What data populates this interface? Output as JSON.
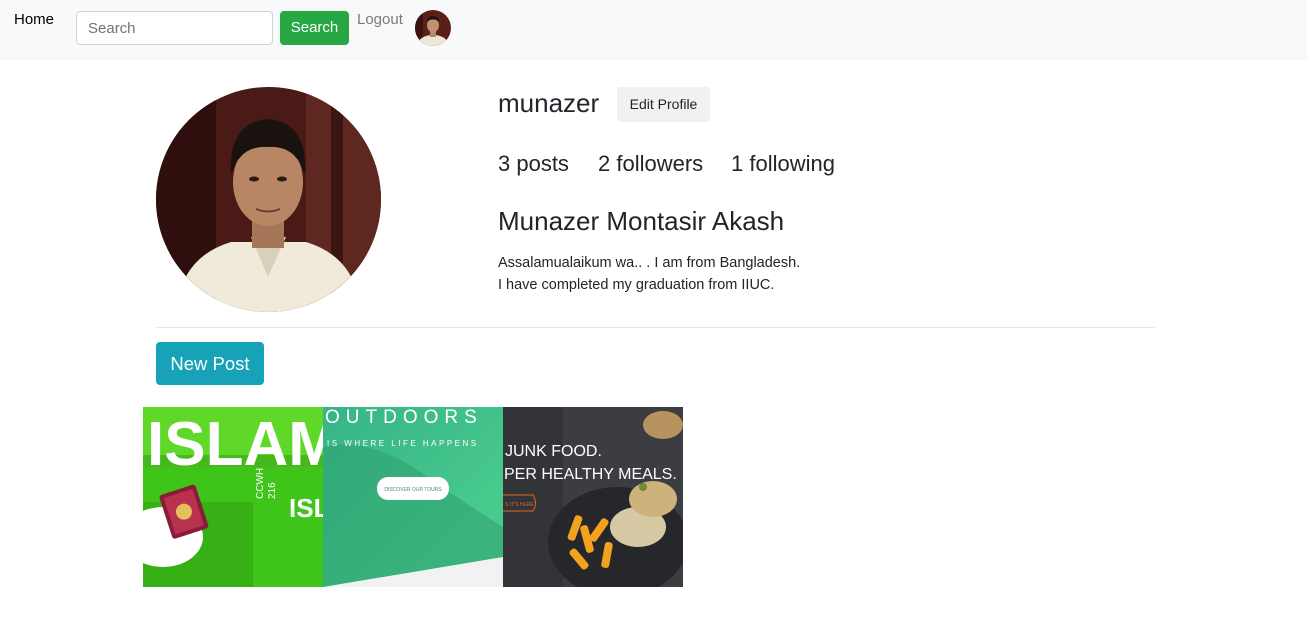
{
  "nav": {
    "home_label": "Home",
    "search_placeholder": "Search",
    "search_button_label": "Search",
    "logout_label": "Logout"
  },
  "profile": {
    "username": "munazer",
    "edit_button_label": "Edit Profile",
    "stats": {
      "posts": "3 posts",
      "followers": "2 followers",
      "following": "1 following"
    },
    "full_name": "Munazer Montasir Akash",
    "bio_lines": [
      "Assalamualaikum wa.. . I am from Bangladesh.",
      "I have completed my graduation from IIUC."
    ]
  },
  "actions": {
    "new_post_label": "New Post"
  },
  "posts": [
    {
      "id": "islam",
      "texts": [
        "ISLAM",
        "CCWH",
        "216",
        "ISLA"
      ]
    },
    {
      "id": "outdoors",
      "texts": [
        "OUTDOORS",
        "IS WHERE LIFE HAPPENS",
        "DISCOVER OUR TOURS"
      ]
    },
    {
      "id": "food",
      "texts": [
        "JUNK FOOD.",
        "PER HEALTHY MEALS.",
        "S IT'S HERE"
      ]
    }
  ],
  "colors": {
    "search_button": "#28a745",
    "new_post_button": "#17a2b8",
    "navbar_bg": "#f8f9fa"
  }
}
